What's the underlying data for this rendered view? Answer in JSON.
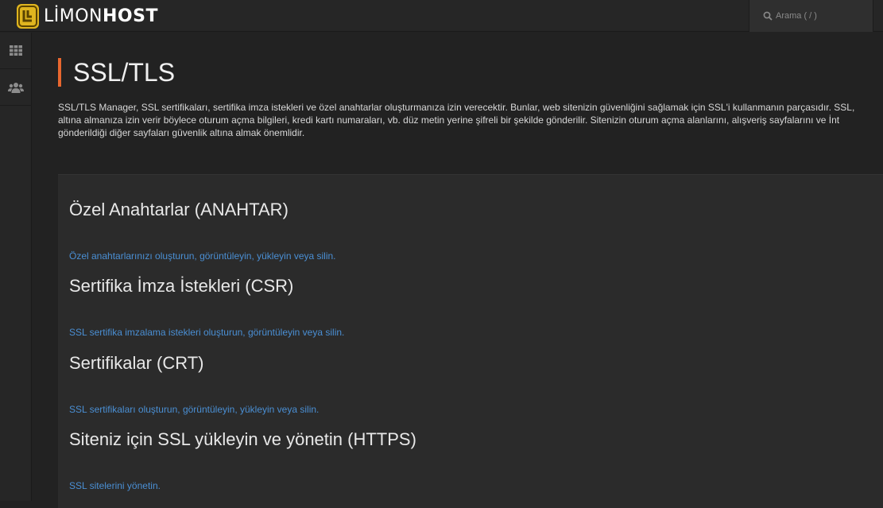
{
  "brand": {
    "thin": "LİMON",
    "bold": "HOST"
  },
  "search": {
    "placeholder": "Arama ( / )"
  },
  "sidebar": {
    "items": [
      "apps-grid-icon",
      "users-icon"
    ]
  },
  "page": {
    "title": "SSL/TLS",
    "intro_lines": [
      "SSL/TLS Manager, SSL sertifikaları, sertifika imza istekleri ve özel anahtarlar oluşturmanıza izin verecektir. Bunlar, web sitenizin güvenliğini sağlamak için SSL'i kullanmanın parçasıdır. SSL,",
      "altına almanıza izin verir böylece oturum açma bilgileri, kredi kartı numaraları, vb. düz metin yerine şifreli bir şekilde gönderilir. Sitenizin oturum açma alanlarını, alışveriş sayfalarını ve İnt",
      "gönderildiği diğer sayfaları güvenlik altına almak önemlidir."
    ]
  },
  "sections": [
    {
      "title": "Özel Anahtarlar (ANAHTAR)",
      "link": "Özel anahtarlarınızı oluşturun, görüntüleyin, yükleyin veya silin."
    },
    {
      "title": "Sertifika İmza İstekleri (CSR)",
      "link": "SSL sertifika imzalama istekleri oluşturun, görüntüleyin veya silin."
    },
    {
      "title": "Sertifikalar (CRT)",
      "link": "SSL sertifikaları oluşturun, görüntüleyin, yükleyin veya silin."
    },
    {
      "title": "Siteniz için SSL yükleyin ve yönetin (HTTPS)",
      "link": "SSL sitelerini yönetin."
    }
  ],
  "colors": {
    "accent": "#e8672f",
    "link": "#4a8fd4",
    "brand": "#e0b51f"
  }
}
